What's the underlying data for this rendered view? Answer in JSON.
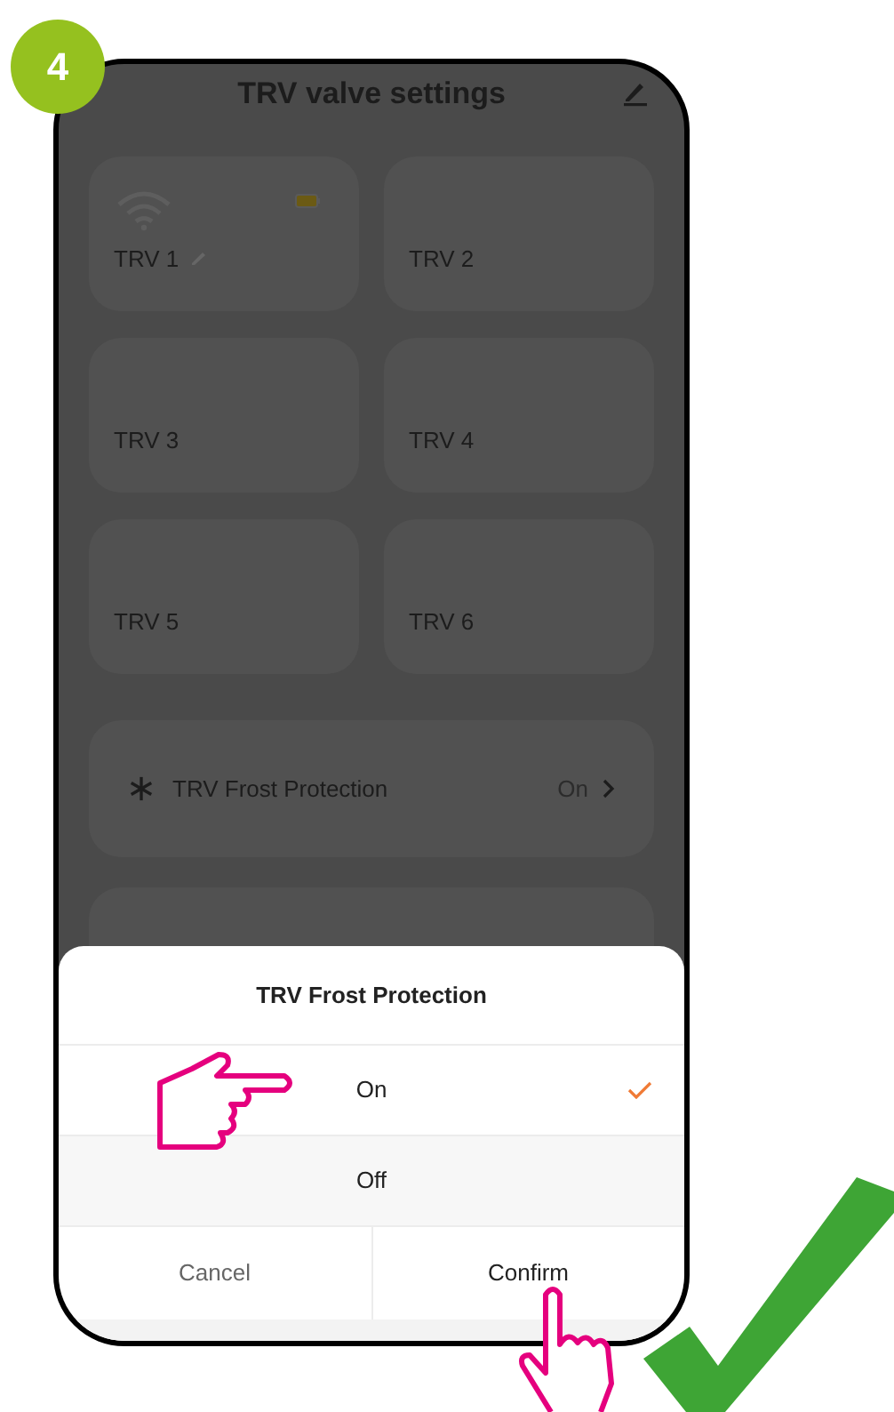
{
  "step": "4",
  "header": {
    "title": "TRV valve settings"
  },
  "devices": [
    {
      "name": "TRV 1",
      "wifi": true,
      "battery": true,
      "editable": true
    },
    {
      "name": "TRV 2",
      "wifi": false,
      "battery": false,
      "editable": false
    },
    {
      "name": "TRV 3",
      "wifi": false,
      "battery": false,
      "editable": false
    },
    {
      "name": "TRV 4",
      "wifi": false,
      "battery": false,
      "editable": false
    },
    {
      "name": "TRV 5",
      "wifi": false,
      "battery": false,
      "editable": false
    },
    {
      "name": "TRV 6",
      "wifi": false,
      "battery": false,
      "editable": false
    }
  ],
  "settings": [
    {
      "label": "TRV Frost Protection",
      "value": "On"
    }
  ],
  "sheet": {
    "title": "TRV Frost Protection",
    "options": [
      {
        "label": "On",
        "selected": true
      },
      {
        "label": "Off",
        "selected": false
      }
    ],
    "buttons": [
      {
        "label": "Cancel",
        "kind": "cancel"
      },
      {
        "label": "Confirm",
        "kind": "confirm"
      }
    ]
  }
}
